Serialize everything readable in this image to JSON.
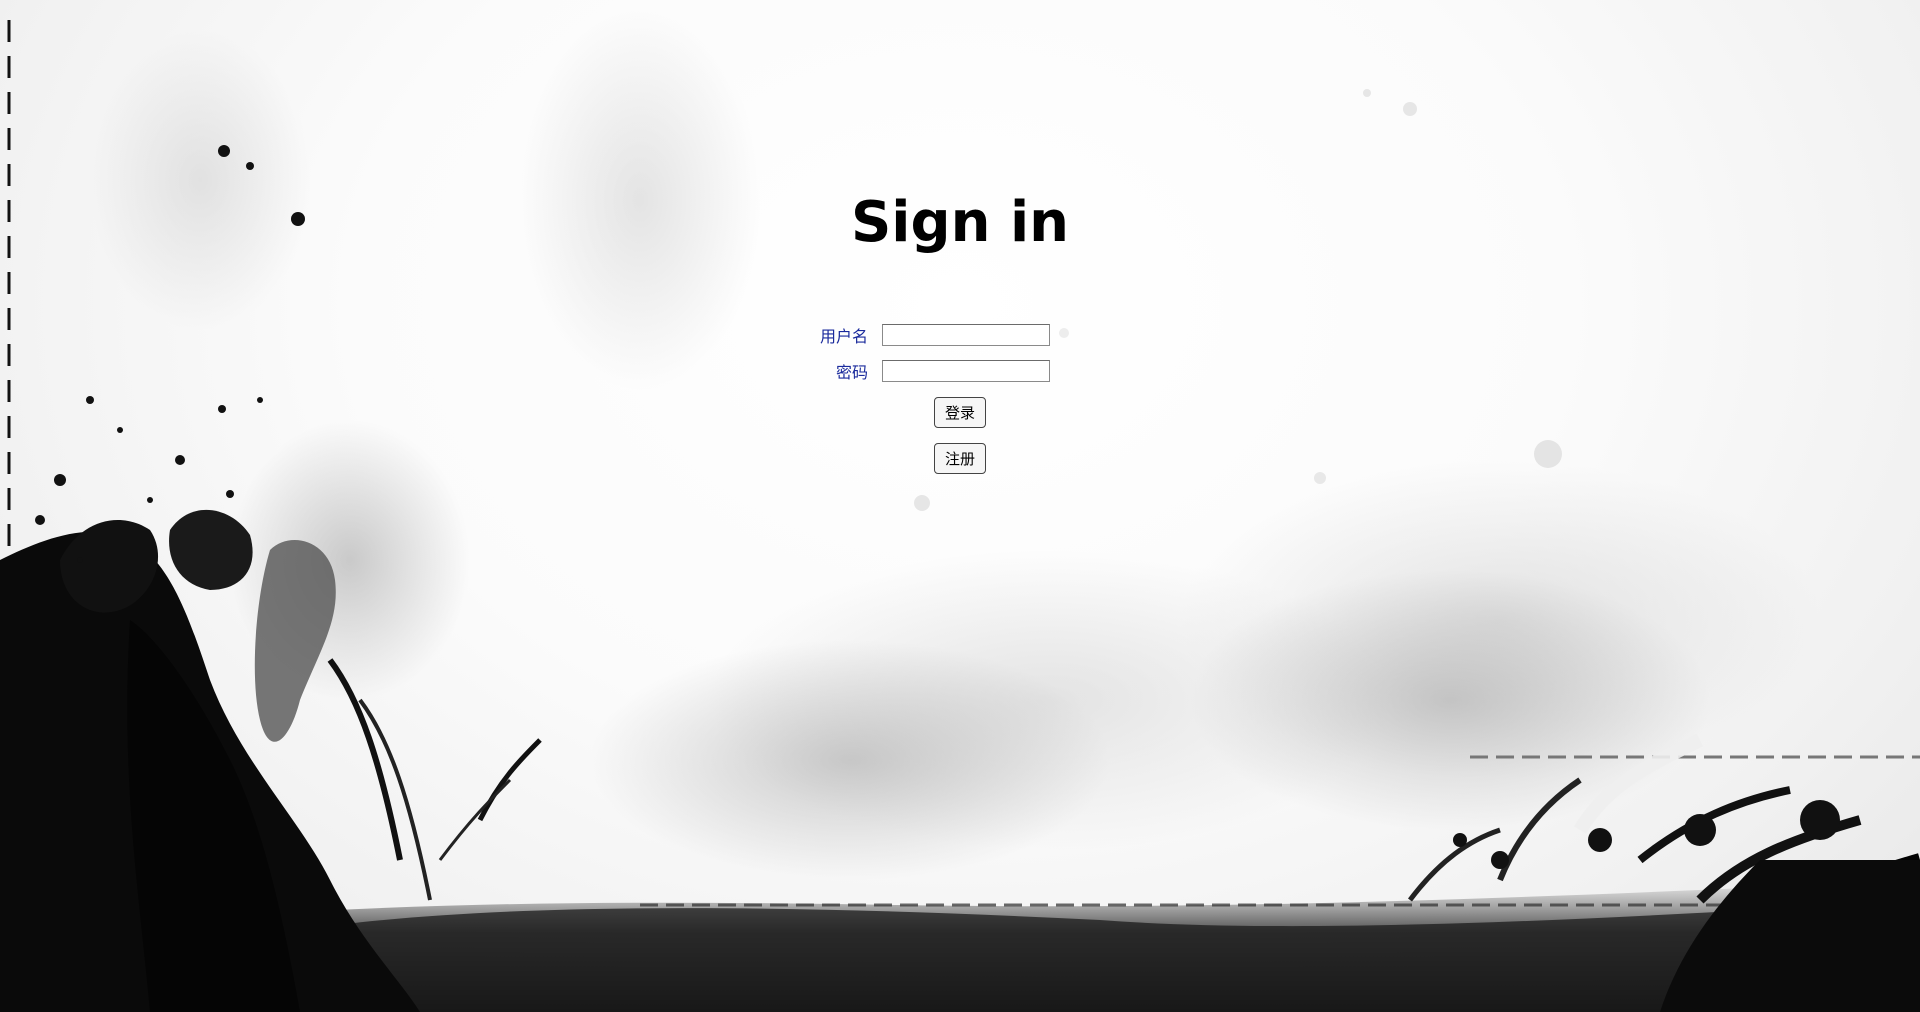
{
  "login": {
    "title": "Sign in",
    "username_label": "用户名",
    "username_value": "",
    "password_label": "密码",
    "password_value": "",
    "login_button": "登录",
    "register_button": "注册"
  },
  "colors": {
    "label": "#1a2a9c",
    "title": "#000000",
    "ink": "#000000"
  }
}
